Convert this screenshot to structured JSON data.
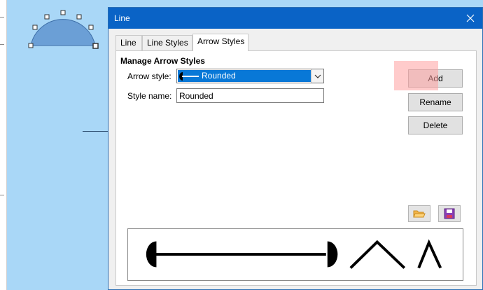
{
  "dialog": {
    "title": "Line",
    "tabs": [
      {
        "label": "Line"
      },
      {
        "label": "Line Styles"
      },
      {
        "label": "Arrow Styles"
      }
    ],
    "section_title": "Manage Arrow Styles",
    "arrow_style_label": "Arrow style:",
    "arrow_style_value": "Rounded",
    "style_name_label": "Style name:",
    "style_name_value": "Rounded",
    "buttons": {
      "add": "Add",
      "rename": "Rename",
      "delete": "Delete"
    },
    "icons": {
      "load": "folder-open-icon",
      "save": "save-floppy-icon",
      "close": "close-icon"
    }
  },
  "colors": {
    "titlebar": "#0a63c6",
    "selection": "#0878d7",
    "canvas": "#a9d7f7",
    "shape_fill": "#6b9fd6",
    "highlight": "#ffa0a0"
  }
}
